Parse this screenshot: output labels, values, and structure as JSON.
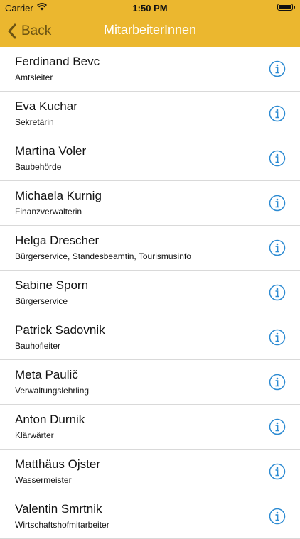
{
  "status_bar": {
    "carrier": "Carrier",
    "time": "1:50 PM"
  },
  "nav": {
    "back_label": "Back",
    "title": "MitarbeiterInnen"
  },
  "colors": {
    "bar": "#ebb72f",
    "accent": "#2b8ad2"
  },
  "employees": [
    {
      "name": "Ferdinand Bevc",
      "role": "Amtsleiter"
    },
    {
      "name": "Eva Kuchar",
      "role": "Sekretärin"
    },
    {
      "name": "Martina Voler",
      "role": "Baubehörde"
    },
    {
      "name": "Michaela Kurnig",
      "role": "Finanzverwalterin"
    },
    {
      "name": "Helga Drescher",
      "role": "Bürgerservice, Standesbeamtin, Tourismusinfo"
    },
    {
      "name": "Sabine Sporn",
      "role": "Bürgerservice"
    },
    {
      "name": "Patrick Sadovnik",
      "role": "Bauhofleiter"
    },
    {
      "name": "Meta Paulič",
      "role": "Verwaltungslehrling"
    },
    {
      "name": "Anton Durnik",
      "role": "Klärwärter"
    },
    {
      "name": "Matthäus Ojster",
      "role": "Wassermeister"
    },
    {
      "name": "Valentin Smrtnik",
      "role": "Wirtschaftshofmitarbeiter"
    }
  ]
}
